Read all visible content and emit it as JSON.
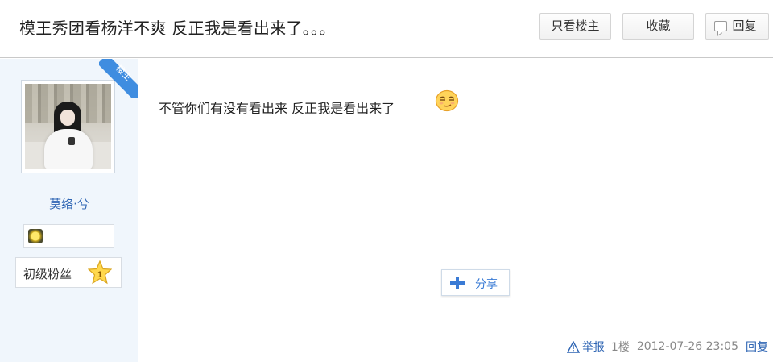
{
  "header": {
    "title": "模王秀团看杨洋不爽 反正我是看出来了。。。",
    "only_op_label": "只看楼主",
    "favorite_label": "收藏",
    "reply_label": "回复"
  },
  "author": {
    "badge": "楼主",
    "username": "莫络·兮",
    "fan_level_label": "初级粉丝",
    "fan_level_number": "1"
  },
  "post": {
    "content": "不管你们有没有看出来 反正我是看出来了",
    "emoji": "smug-face-emoji",
    "share_label": "分享"
  },
  "footer": {
    "report_label": "举报",
    "floor": "1楼",
    "time": "2012-07-26 23:05",
    "reply_label": "回复"
  },
  "colors": {
    "link_blue": "#2d64b3",
    "sidebar_bg": "#f0f6fc",
    "badge_blue": "#3f8de0"
  }
}
